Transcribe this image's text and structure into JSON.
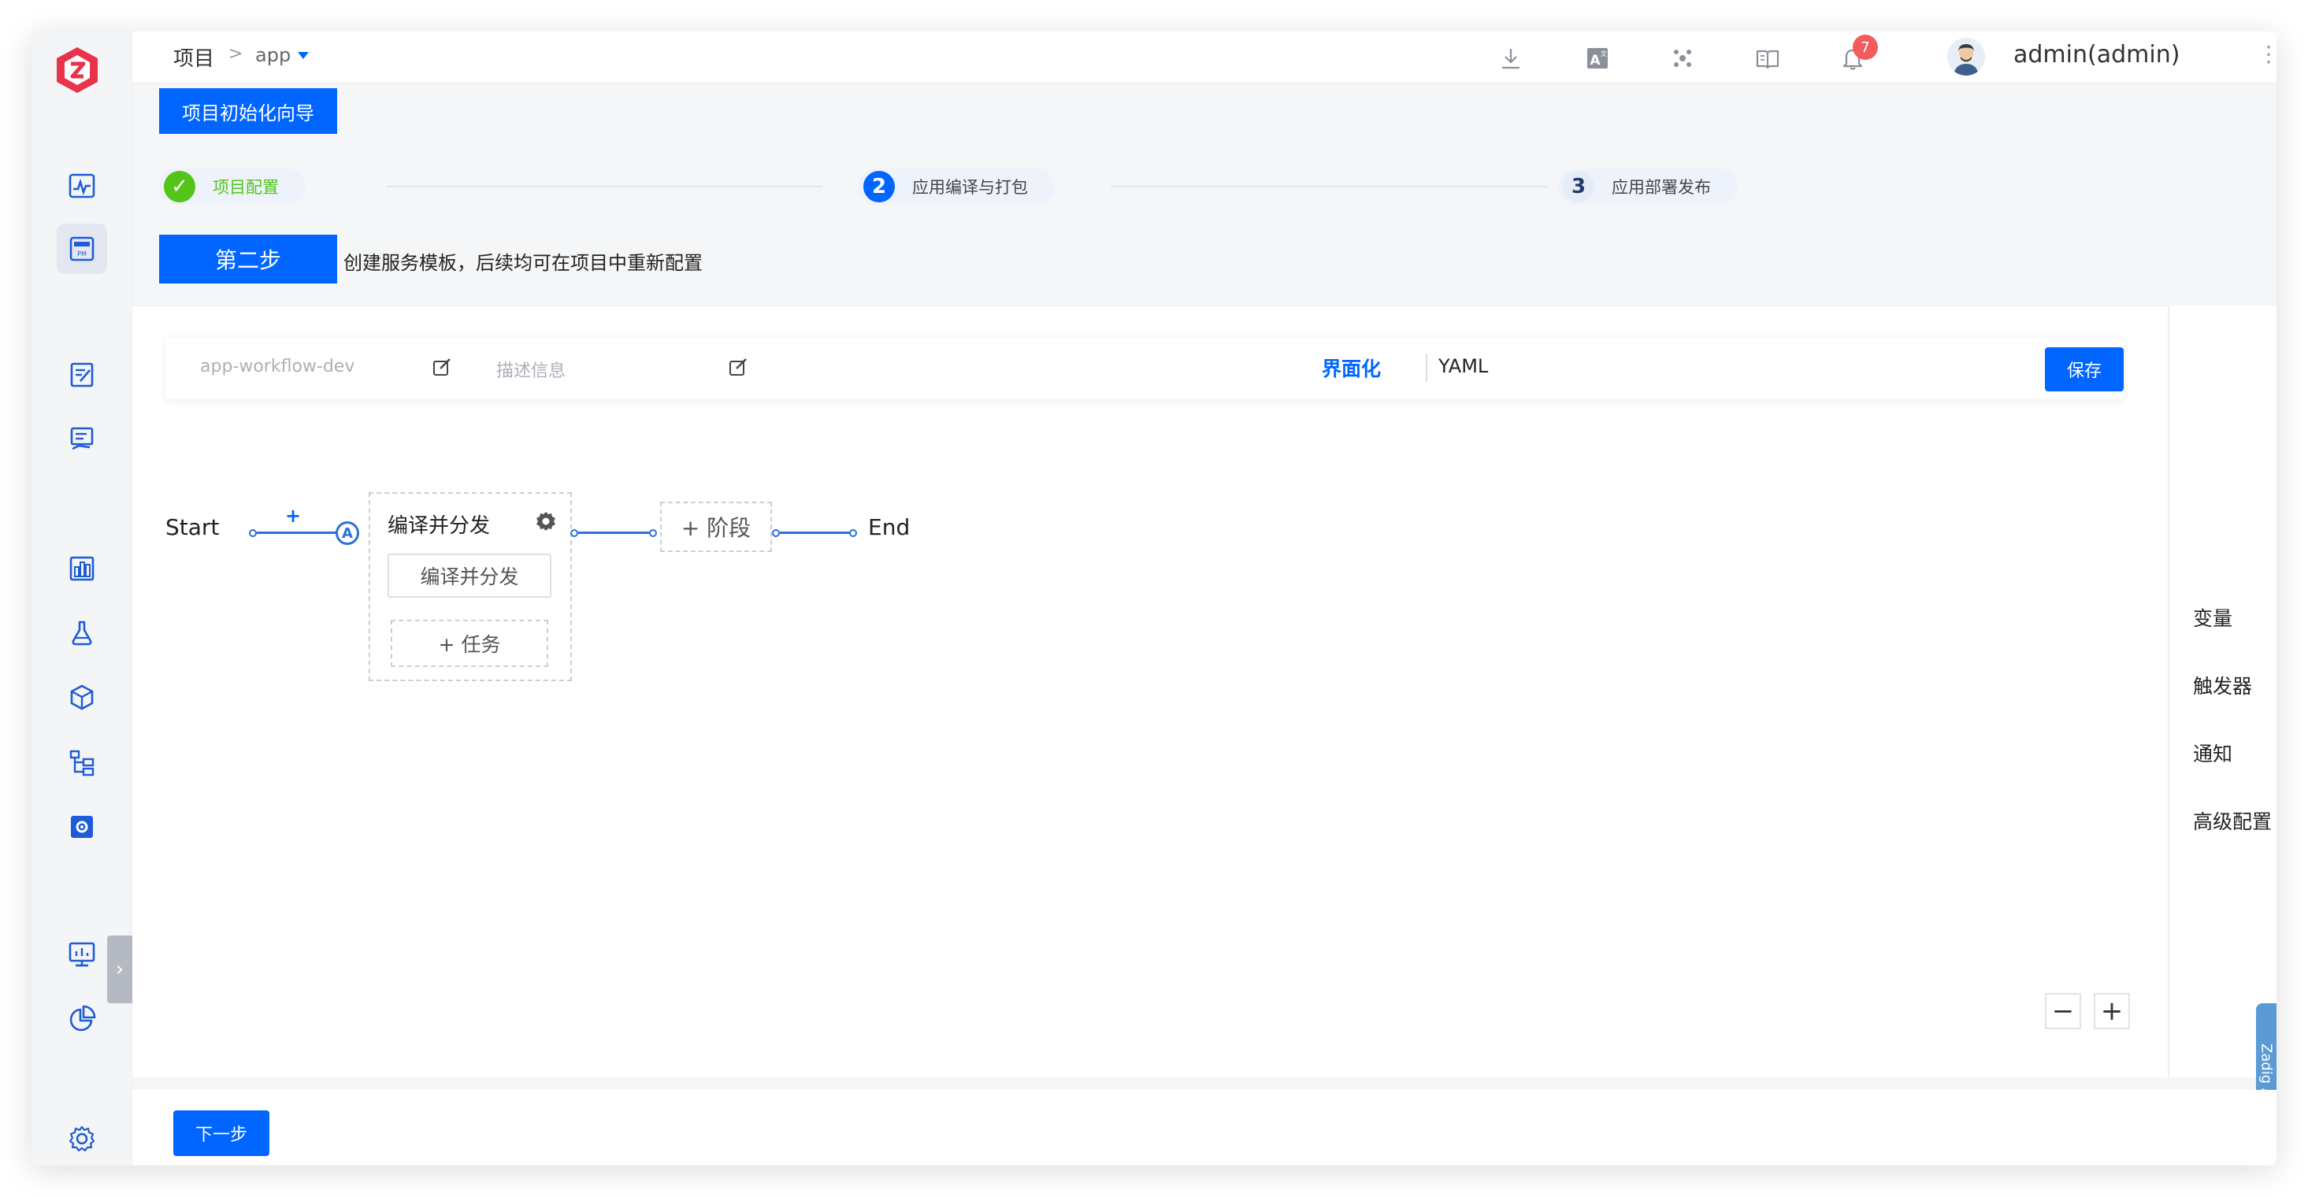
{
  "header": {
    "breadcrumb_project": "项目",
    "breadcrumb_sep": ">",
    "breadcrumb_app": "app",
    "notification_count": "7",
    "user": "admin(admin)",
    "more": "⋮"
  },
  "wizard": {
    "title": "项目初始化向导",
    "steps": [
      {
        "num": "✓",
        "label": "项目配置"
      },
      {
        "num": "2",
        "label": "应用编译与打包"
      },
      {
        "num": "3",
        "label": "应用部署发布"
      }
    ],
    "current_tag": "第二步",
    "current_desc": "创建服务模板，后续均可在项目中重新配置"
  },
  "toolbar": {
    "workflow_name": "app-workflow-dev",
    "description_placeholder": "描述信息",
    "tab_ui": "界面化",
    "tab_yaml": "YAML",
    "save_label": "保存"
  },
  "workflow": {
    "start_label": "Start",
    "end_label": "End",
    "plus": "+",
    "start_marker": "A",
    "stage_title": "编译并分发",
    "job_label": "编译并分发",
    "add_task_label": "+ 任务",
    "add_stage_label": "+ 阶段"
  },
  "zoom": {
    "minus": "−",
    "plus": "+"
  },
  "right_panel": {
    "items": [
      "变量",
      "触发器",
      "通知",
      "高级配置"
    ],
    "ai_tab": "Zadig AI"
  },
  "footer": {
    "next_label": "下一步"
  },
  "colors": {
    "primary": "#0066ff",
    "success": "#52c41a",
    "badge": "#f25c5c"
  }
}
